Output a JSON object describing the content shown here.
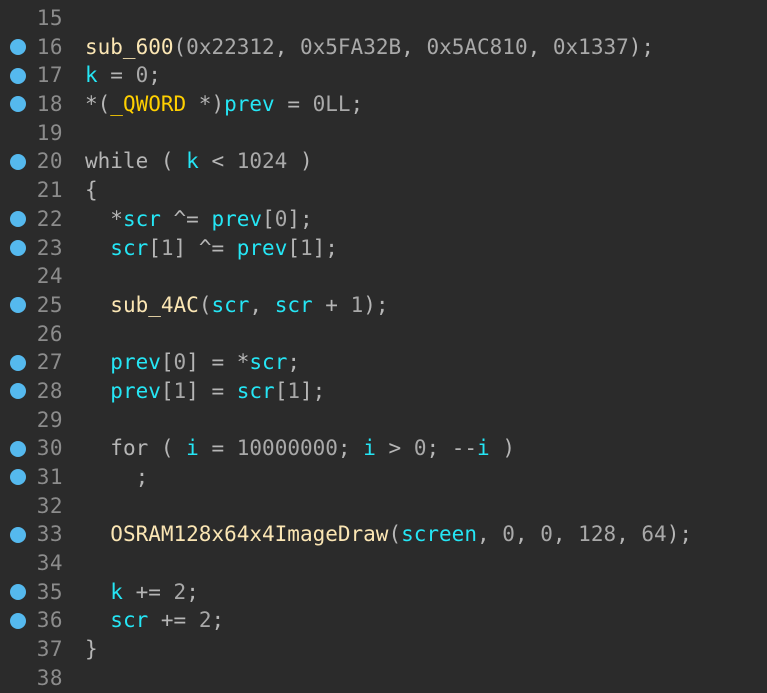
{
  "editor": {
    "kind": "decompiler-pseudocode-view",
    "background_color": "#2b2b2b",
    "gutter_text_color": "#8c8c8c",
    "breakpoint_color": "#55b9ee",
    "colors": {
      "plain": "#b6b6b6",
      "keyword": "#b6b6b6",
      "number": "#a9a9a9",
      "variable": "#25e6f5",
      "function": "#fbe6b4",
      "type": "#ffd000"
    },
    "first_line_number": 15,
    "last_line_number": 38,
    "lines": [
      {
        "number": "15",
        "breakpoint": false,
        "text": "",
        "tokens": []
      },
      {
        "number": "16",
        "breakpoint": true,
        "text": "sub_600(0x22312, 0x5FA32B, 0x5AC810, 0x1337);",
        "tokens": [
          {
            "t": "sub_600",
            "c": "func"
          },
          {
            "t": "(",
            "c": "punct"
          },
          {
            "t": "0x22312",
            "c": "num"
          },
          {
            "t": ", ",
            "c": "punct"
          },
          {
            "t": "0x5FA32B",
            "c": "num"
          },
          {
            "t": ", ",
            "c": "punct"
          },
          {
            "t": "0x5AC810",
            "c": "num"
          },
          {
            "t": ", ",
            "c": "punct"
          },
          {
            "t": "0x1337",
            "c": "num"
          },
          {
            "t": ");",
            "c": "punct"
          }
        ]
      },
      {
        "number": "17",
        "breakpoint": true,
        "text": "k = 0;",
        "tokens": [
          {
            "t": "k",
            "c": "var"
          },
          {
            "t": " = ",
            "c": "punct"
          },
          {
            "t": "0",
            "c": "num"
          },
          {
            "t": ";",
            "c": "punct"
          }
        ]
      },
      {
        "number": "18",
        "breakpoint": true,
        "text": "*(_QWORD *)prev = 0LL;",
        "tokens": [
          {
            "t": "*(",
            "c": "punct"
          },
          {
            "t": "_QWORD",
            "c": "type"
          },
          {
            "t": " *)",
            "c": "punct"
          },
          {
            "t": "prev",
            "c": "var"
          },
          {
            "t": " = ",
            "c": "punct"
          },
          {
            "t": "0LL",
            "c": "num"
          },
          {
            "t": ";",
            "c": "punct"
          }
        ]
      },
      {
        "number": "19",
        "breakpoint": false,
        "text": "",
        "tokens": []
      },
      {
        "number": "20",
        "breakpoint": true,
        "text": "while ( k < 1024 )",
        "tokens": [
          {
            "t": "while",
            "c": "kw"
          },
          {
            "t": " ( ",
            "c": "punct"
          },
          {
            "t": "k",
            "c": "var"
          },
          {
            "t": " < ",
            "c": "punct"
          },
          {
            "t": "1024",
            "c": "num"
          },
          {
            "t": " )",
            "c": "punct"
          }
        ]
      },
      {
        "number": "21",
        "breakpoint": false,
        "text": "{",
        "tokens": [
          {
            "t": "{",
            "c": "punct"
          }
        ]
      },
      {
        "number": "22",
        "breakpoint": true,
        "text": "  *scr ^= prev[0];",
        "tokens": [
          {
            "t": "  *",
            "c": "punct"
          },
          {
            "t": "scr",
            "c": "var"
          },
          {
            "t": " ^= ",
            "c": "punct"
          },
          {
            "t": "prev",
            "c": "var"
          },
          {
            "t": "[",
            "c": "punct"
          },
          {
            "t": "0",
            "c": "num"
          },
          {
            "t": "];",
            "c": "punct"
          }
        ]
      },
      {
        "number": "23",
        "breakpoint": true,
        "text": "  scr[1] ^= prev[1];",
        "tokens": [
          {
            "t": "  ",
            "c": "punct"
          },
          {
            "t": "scr",
            "c": "var"
          },
          {
            "t": "[",
            "c": "punct"
          },
          {
            "t": "1",
            "c": "num"
          },
          {
            "t": "] ^= ",
            "c": "punct"
          },
          {
            "t": "prev",
            "c": "var"
          },
          {
            "t": "[",
            "c": "punct"
          },
          {
            "t": "1",
            "c": "num"
          },
          {
            "t": "];",
            "c": "punct"
          }
        ]
      },
      {
        "number": "24",
        "breakpoint": false,
        "text": "",
        "tokens": []
      },
      {
        "number": "25",
        "breakpoint": true,
        "text": "  sub_4AC(scr, scr + 1);",
        "tokens": [
          {
            "t": "  ",
            "c": "punct"
          },
          {
            "t": "sub_4AC",
            "c": "func"
          },
          {
            "t": "(",
            "c": "punct"
          },
          {
            "t": "scr",
            "c": "var"
          },
          {
            "t": ", ",
            "c": "punct"
          },
          {
            "t": "scr",
            "c": "var"
          },
          {
            "t": " + ",
            "c": "punct"
          },
          {
            "t": "1",
            "c": "num"
          },
          {
            "t": ");",
            "c": "punct"
          }
        ]
      },
      {
        "number": "26",
        "breakpoint": false,
        "text": "",
        "tokens": []
      },
      {
        "number": "27",
        "breakpoint": true,
        "text": "  prev[0] = *scr;",
        "tokens": [
          {
            "t": "  ",
            "c": "punct"
          },
          {
            "t": "prev",
            "c": "var"
          },
          {
            "t": "[",
            "c": "punct"
          },
          {
            "t": "0",
            "c": "num"
          },
          {
            "t": "] = *",
            "c": "punct"
          },
          {
            "t": "scr",
            "c": "var"
          },
          {
            "t": ";",
            "c": "punct"
          }
        ]
      },
      {
        "number": "28",
        "breakpoint": true,
        "text": "  prev[1] = scr[1];",
        "tokens": [
          {
            "t": "  ",
            "c": "punct"
          },
          {
            "t": "prev",
            "c": "var"
          },
          {
            "t": "[",
            "c": "punct"
          },
          {
            "t": "1",
            "c": "num"
          },
          {
            "t": "] = ",
            "c": "punct"
          },
          {
            "t": "scr",
            "c": "var"
          },
          {
            "t": "[",
            "c": "punct"
          },
          {
            "t": "1",
            "c": "num"
          },
          {
            "t": "];",
            "c": "punct"
          }
        ]
      },
      {
        "number": "29",
        "breakpoint": false,
        "text": "",
        "tokens": []
      },
      {
        "number": "30",
        "breakpoint": true,
        "text": "  for ( i = 10000000; i > 0; --i )",
        "tokens": [
          {
            "t": "  ",
            "c": "punct"
          },
          {
            "t": "for",
            "c": "kw"
          },
          {
            "t": " ( ",
            "c": "punct"
          },
          {
            "t": "i",
            "c": "var"
          },
          {
            "t": " = ",
            "c": "punct"
          },
          {
            "t": "10000000",
            "c": "num"
          },
          {
            "t": "; ",
            "c": "punct"
          },
          {
            "t": "i",
            "c": "var"
          },
          {
            "t": " > ",
            "c": "punct"
          },
          {
            "t": "0",
            "c": "num"
          },
          {
            "t": "; --",
            "c": "punct"
          },
          {
            "t": "i",
            "c": "var"
          },
          {
            "t": " )",
            "c": "punct"
          }
        ]
      },
      {
        "number": "31",
        "breakpoint": true,
        "text": "    ;",
        "tokens": [
          {
            "t": "    ;",
            "c": "punct"
          }
        ]
      },
      {
        "number": "32",
        "breakpoint": false,
        "text": "",
        "tokens": []
      },
      {
        "number": "33",
        "breakpoint": true,
        "text": "  OSRAM128x64x4ImageDraw(screen, 0, 0, 128, 64);",
        "tokens": [
          {
            "t": "  ",
            "c": "punct"
          },
          {
            "t": "OSRAM128x64x4ImageDraw",
            "c": "func"
          },
          {
            "t": "(",
            "c": "punct"
          },
          {
            "t": "screen",
            "c": "var"
          },
          {
            "t": ", ",
            "c": "punct"
          },
          {
            "t": "0",
            "c": "num"
          },
          {
            "t": ", ",
            "c": "punct"
          },
          {
            "t": "0",
            "c": "num"
          },
          {
            "t": ", ",
            "c": "punct"
          },
          {
            "t": "128",
            "c": "num"
          },
          {
            "t": ", ",
            "c": "punct"
          },
          {
            "t": "64",
            "c": "num"
          },
          {
            "t": ");",
            "c": "punct"
          }
        ]
      },
      {
        "number": "34",
        "breakpoint": false,
        "text": "",
        "tokens": []
      },
      {
        "number": "35",
        "breakpoint": true,
        "text": "  k += 2;",
        "tokens": [
          {
            "t": "  ",
            "c": "punct"
          },
          {
            "t": "k",
            "c": "var"
          },
          {
            "t": " += ",
            "c": "punct"
          },
          {
            "t": "2",
            "c": "num"
          },
          {
            "t": ";",
            "c": "punct"
          }
        ]
      },
      {
        "number": "36",
        "breakpoint": true,
        "text": "  scr += 2;",
        "tokens": [
          {
            "t": "  ",
            "c": "punct"
          },
          {
            "t": "scr",
            "c": "var"
          },
          {
            "t": " += ",
            "c": "punct"
          },
          {
            "t": "2",
            "c": "num"
          },
          {
            "t": ";",
            "c": "punct"
          }
        ]
      },
      {
        "number": "37",
        "breakpoint": false,
        "text": "}",
        "tokens": [
          {
            "t": "}",
            "c": "punct"
          }
        ]
      },
      {
        "number": "38",
        "breakpoint": false,
        "text": "",
        "tokens": []
      }
    ]
  }
}
